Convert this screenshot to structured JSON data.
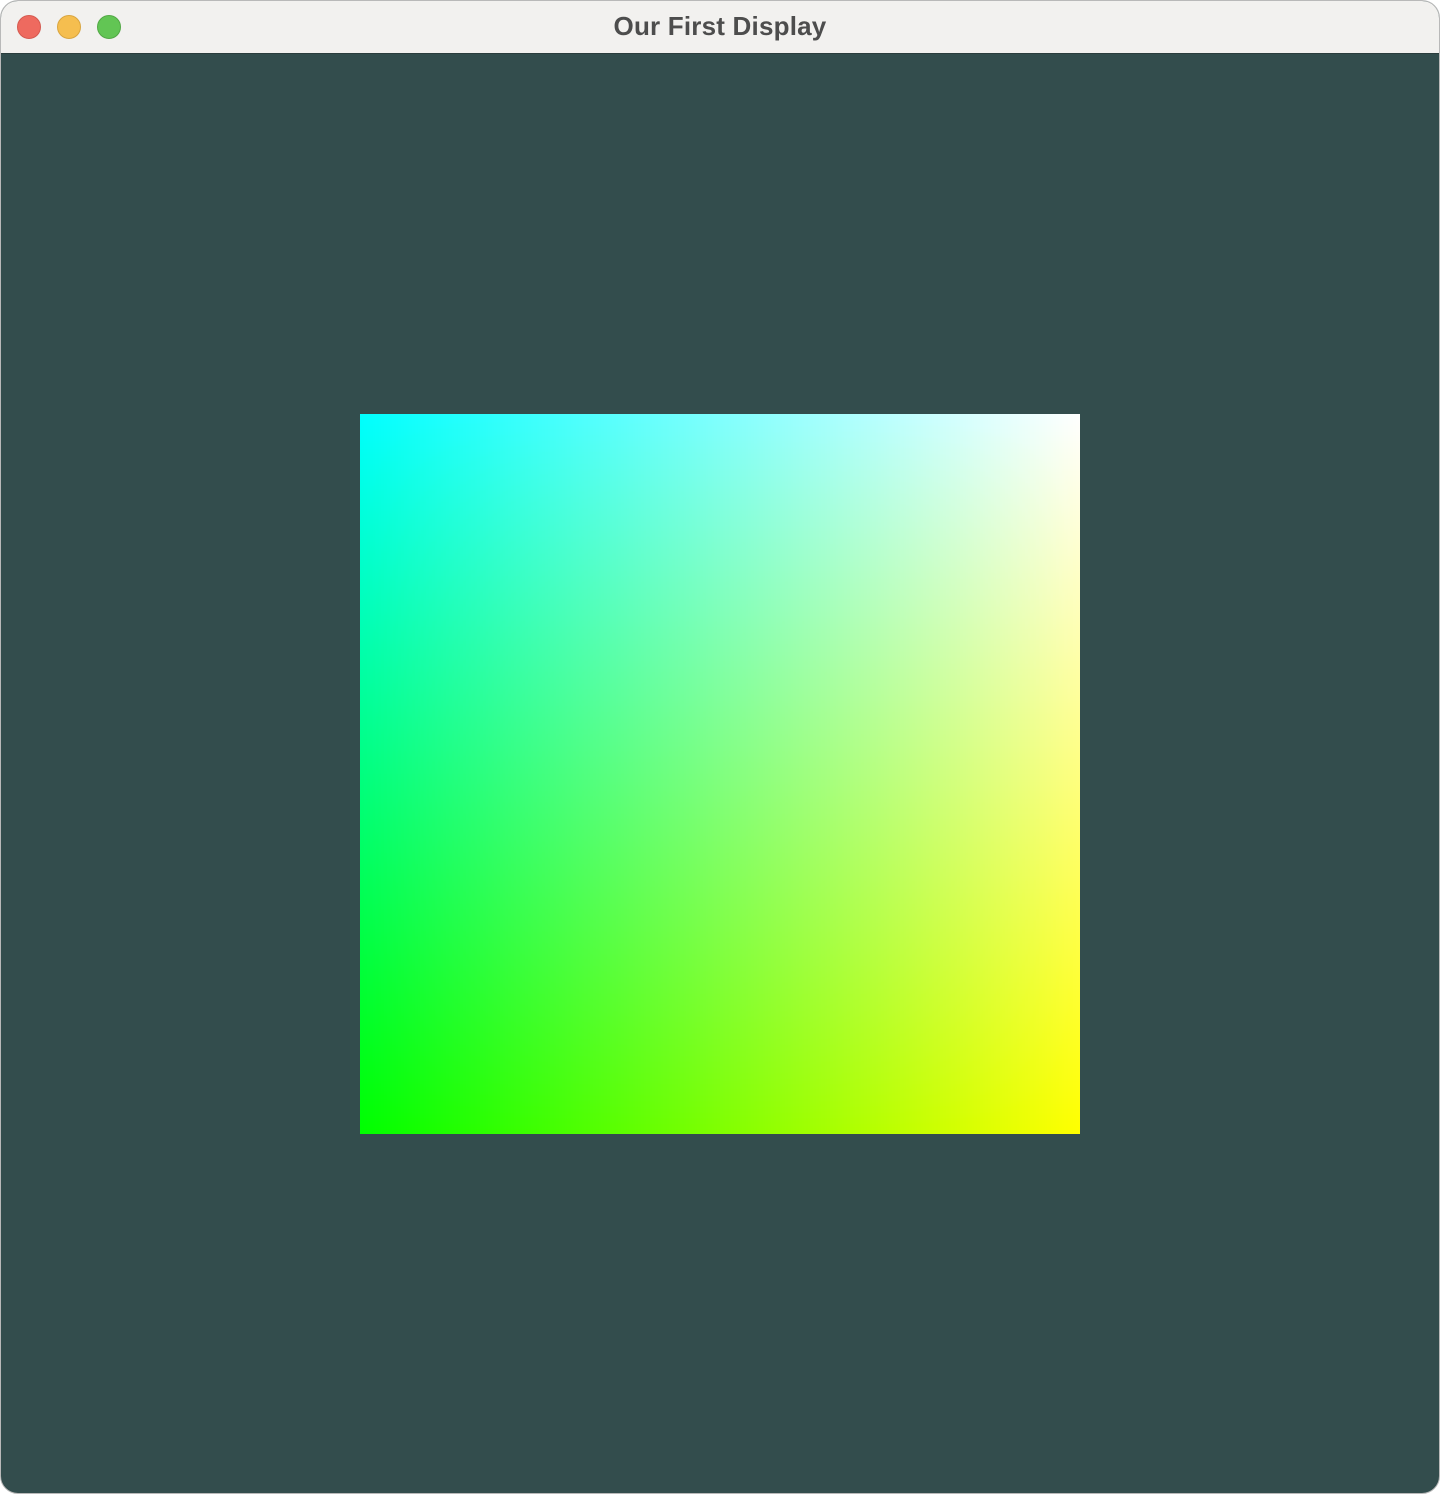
{
  "window": {
    "title": "Our First Display"
  },
  "traffic_lights": {
    "close": {
      "icon": "close-traffic-light-icon",
      "color": "#ee6a5f",
      "border": "#d55a50"
    },
    "minimize": {
      "icon": "minimize-traffic-light-icon",
      "color": "#f5be4f",
      "border": "#d9a53f"
    },
    "zoom": {
      "icon": "zoom-traffic-light-icon",
      "color": "#62c554",
      "border": "#52a845"
    }
  },
  "canvas": {
    "clear_color": "#334d4d",
    "quad_corner_colors": {
      "top_left": "#00ffff",
      "top_right": "#ffffff",
      "bottom_left": "#00ff00",
      "bottom_right": "#ffff00"
    }
  }
}
